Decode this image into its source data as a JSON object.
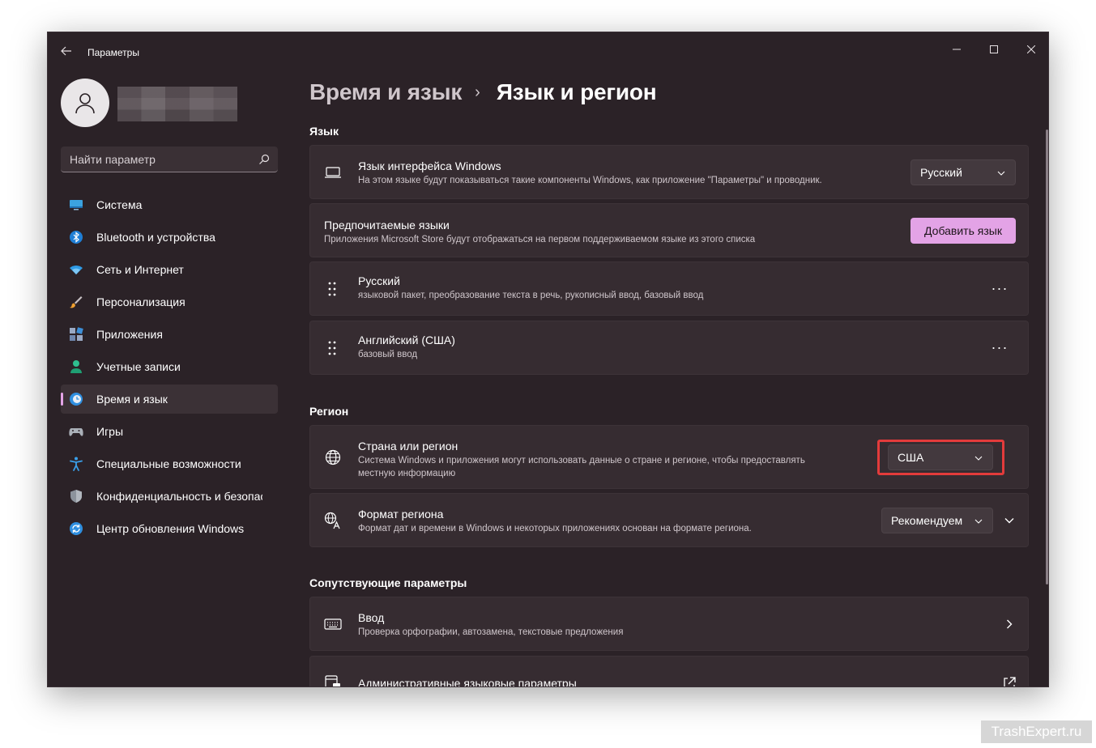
{
  "window": {
    "title": "Параметры"
  },
  "sidebar": {
    "search_placeholder": "Найти параметр",
    "items": [
      {
        "label": "Система",
        "icon": "monitor-icon"
      },
      {
        "label": "Bluetooth и устройства",
        "icon": "bluetooth-icon"
      },
      {
        "label": "Сеть и Интернет",
        "icon": "wifi-icon"
      },
      {
        "label": "Персонализация",
        "icon": "brush-icon"
      },
      {
        "label": "Приложения",
        "icon": "apps-icon"
      },
      {
        "label": "Учетные записи",
        "icon": "person-icon"
      },
      {
        "label": "Время и язык",
        "icon": "clock-globe-icon",
        "active": true
      },
      {
        "label": "Игры",
        "icon": "gamepad-icon"
      },
      {
        "label": "Специальные возможности",
        "icon": "accessibility-icon"
      },
      {
        "label": "Конфиденциальность и безопасность",
        "icon": "shield-icon"
      },
      {
        "label": "Центр обновления Windows",
        "icon": "update-icon"
      }
    ]
  },
  "breadcrumb": {
    "parent": "Время и язык",
    "separator": "›",
    "current": "Язык и регион"
  },
  "language_section": {
    "title": "Язык",
    "display_language": {
      "title": "Язык интерфейса Windows",
      "desc": "На этом языке будут показываться такие компоненты Windows, как приложение \"Параметры\" и проводник.",
      "value": "Русский"
    },
    "preferred": {
      "title": "Предпочитаемые языки",
      "desc": "Приложения Microsoft Store будут отображаться на первом поддерживаемом языке из этого списка",
      "button": "Добавить язык"
    },
    "languages": [
      {
        "title": "Русский",
        "desc": "языковой пакет, преобразование текста в речь, рукописный ввод, базовый ввод",
        "more": "···"
      },
      {
        "title": "Английский (США)",
        "desc": "базовый ввод",
        "more": "···"
      }
    ]
  },
  "region_section": {
    "title": "Регион",
    "country": {
      "title": "Страна или регион",
      "desc_line1": "Система Windows и приложения могут использовать данные о стране и регионе, чтобы предоставлять",
      "desc_line2": "местную информацию",
      "value": "США"
    },
    "format": {
      "title": "Формат региона",
      "desc": "Формат дат и времени в Windows и некоторых приложениях основан на формате региона.",
      "value": "Рекомендуем"
    }
  },
  "related_section": {
    "title": "Сопутствующие параметры",
    "typing": {
      "title": "Ввод",
      "desc": "Проверка орфографии, автозамена, текстовые предложения"
    },
    "admin": {
      "title": "Административные языковые параметры"
    }
  },
  "watermark": "TrashExpert.ru",
  "colors": {
    "accent": "#e3a3e6",
    "highlight": "#e33b3b",
    "window_bg": "#2b2227",
    "card_bg": "#362c31"
  }
}
